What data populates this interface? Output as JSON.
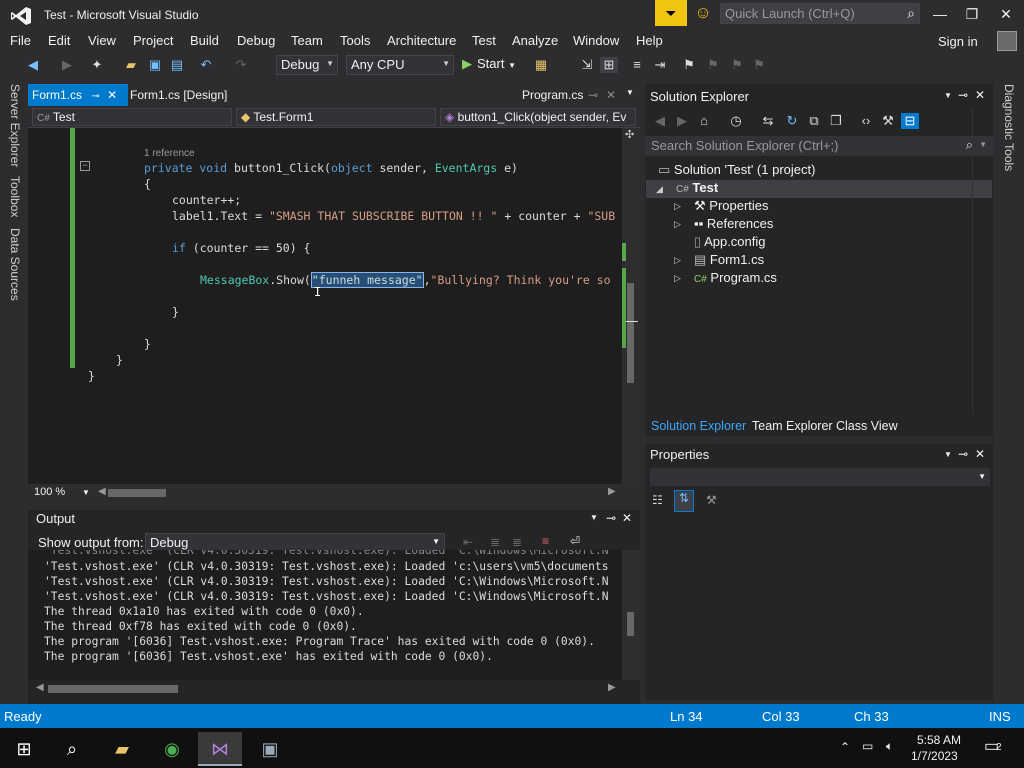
{
  "window": {
    "title": "Test - Microsoft Visual Studio",
    "quick_launch_placeholder": "Quick Launch (Ctrl+Q)"
  },
  "menu": [
    "File",
    "Edit",
    "View",
    "Project",
    "Build",
    "Debug",
    "Team",
    "Tools",
    "Architecture",
    "Test",
    "Analyze",
    "Window",
    "Help"
  ],
  "signin": "Sign in",
  "toolbar": {
    "config": "Debug",
    "platform": "Any CPU",
    "start": "Start"
  },
  "left_rail": [
    "Server Explorer",
    "Toolbox",
    "Data Sources"
  ],
  "right_rail": [
    "Diagnostic Tools"
  ],
  "doc_tabs": [
    {
      "label": "Form1.cs",
      "active": true
    },
    {
      "label": "Form1.cs [Design]",
      "active": false
    },
    {
      "label": "Program.cs",
      "active": false
    }
  ],
  "nav": {
    "project": "Test",
    "class": "Test.Form1",
    "member": "button1_Click(object sender, Ev"
  },
  "code": {
    "ref_count": "1 reference",
    "line_method_kw": "private void",
    "line_method_name": "button1_Click(",
    "line_method_obj": "object",
    "line_method_rest": " sender, ",
    "line_method_type": "EventArgs",
    "line_method_end": " e)",
    "open_brace": "{",
    "counter_inc": "counter++;",
    "label_text_pre": "label1.Text = ",
    "label_text_str": "\"SMASH THAT SUBSCRIBE BUTTON !! \"",
    "label_text_post": " + counter + ",
    "label_text_str2": "\"SUB",
    "if_kw": "if",
    "if_rest": " (counter == 50) {",
    "msgbox_type": "MessageBox",
    "msgbox_call": ".Show(",
    "msgbox_sel": "\"funneh message\"",
    "msgbox_after": ",",
    "msgbox_str": "\"Bullying? Think you're so",
    "close1": "}",
    "close2": "}",
    "close3": "}",
    "close4": "}"
  },
  "editor_zoom": "100 %",
  "output": {
    "title": "Output",
    "show_from_label": "Show output from:",
    "show_from_value": "Debug",
    "lines": [
      "'Test.vshost.exe' (CLR v4.0.30319: Test.vshost.exe): Loaded 'c:\\users\\vm5\\documents",
      "'Test.vshost.exe' (CLR v4.0.30319: Test.vshost.exe): Loaded 'C:\\Windows\\Microsoft.N",
      "'Test.vshost.exe' (CLR v4.0.30319: Test.vshost.exe): Loaded 'C:\\Windows\\Microsoft.N",
      "The thread 0x1a10 has exited with code 0 (0x0).",
      "The thread 0xf78 has exited with code 0 (0x0).",
      "The program '[6036] Test.vshost.exe: Program Trace' has exited with code 0 (0x0).",
      "The program '[6036] Test.vshost.exe' has exited with code 0 (0x0)."
    ]
  },
  "solution_explorer": {
    "title": "Solution Explorer",
    "search_placeholder": "Search Solution Explorer (Ctrl+;)",
    "solution": "Solution 'Test' (1 project)",
    "project": "Test",
    "items": [
      "Properties",
      "References",
      "App.config",
      "Form1.cs",
      "Program.cs"
    ]
  },
  "bottom_tabs": [
    "Solution Explorer",
    "Team Explorer",
    "Class View"
  ],
  "properties": {
    "title": "Properties"
  },
  "status": {
    "state": "Ready",
    "ln": "Ln 34",
    "col": "Col 33",
    "ch": "Ch 33",
    "mode": "INS"
  },
  "clock": {
    "time": "5:58 AM",
    "date": "1/7/2023"
  },
  "notifications": "2",
  "colors": {
    "accent": "#007acc",
    "editor_bg": "#1e1e1e",
    "chrome": "#2d2d30"
  }
}
